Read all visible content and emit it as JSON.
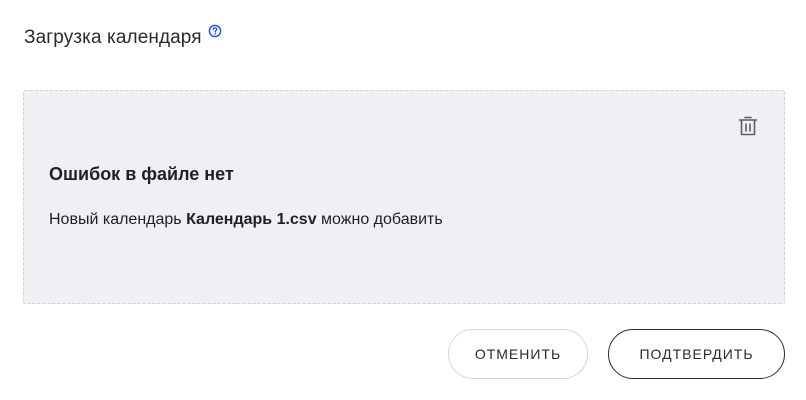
{
  "header": {
    "title": "Загрузка календаря",
    "help_icon": "question-circle-icon"
  },
  "panel": {
    "delete_icon": "trash-icon",
    "heading": "Ошибок в файле нет",
    "text_before": "Новый календарь ",
    "file_name": "Календарь 1.csv",
    "text_after": " можно добавить"
  },
  "actions": {
    "cancel_label": "ОТМЕНИТЬ",
    "confirm_label": "ПОДТВЕРДИТЬ"
  },
  "colors": {
    "panel_bg": "#eff0f4",
    "accent": "#1a4fd6",
    "text": "#1f2024"
  }
}
